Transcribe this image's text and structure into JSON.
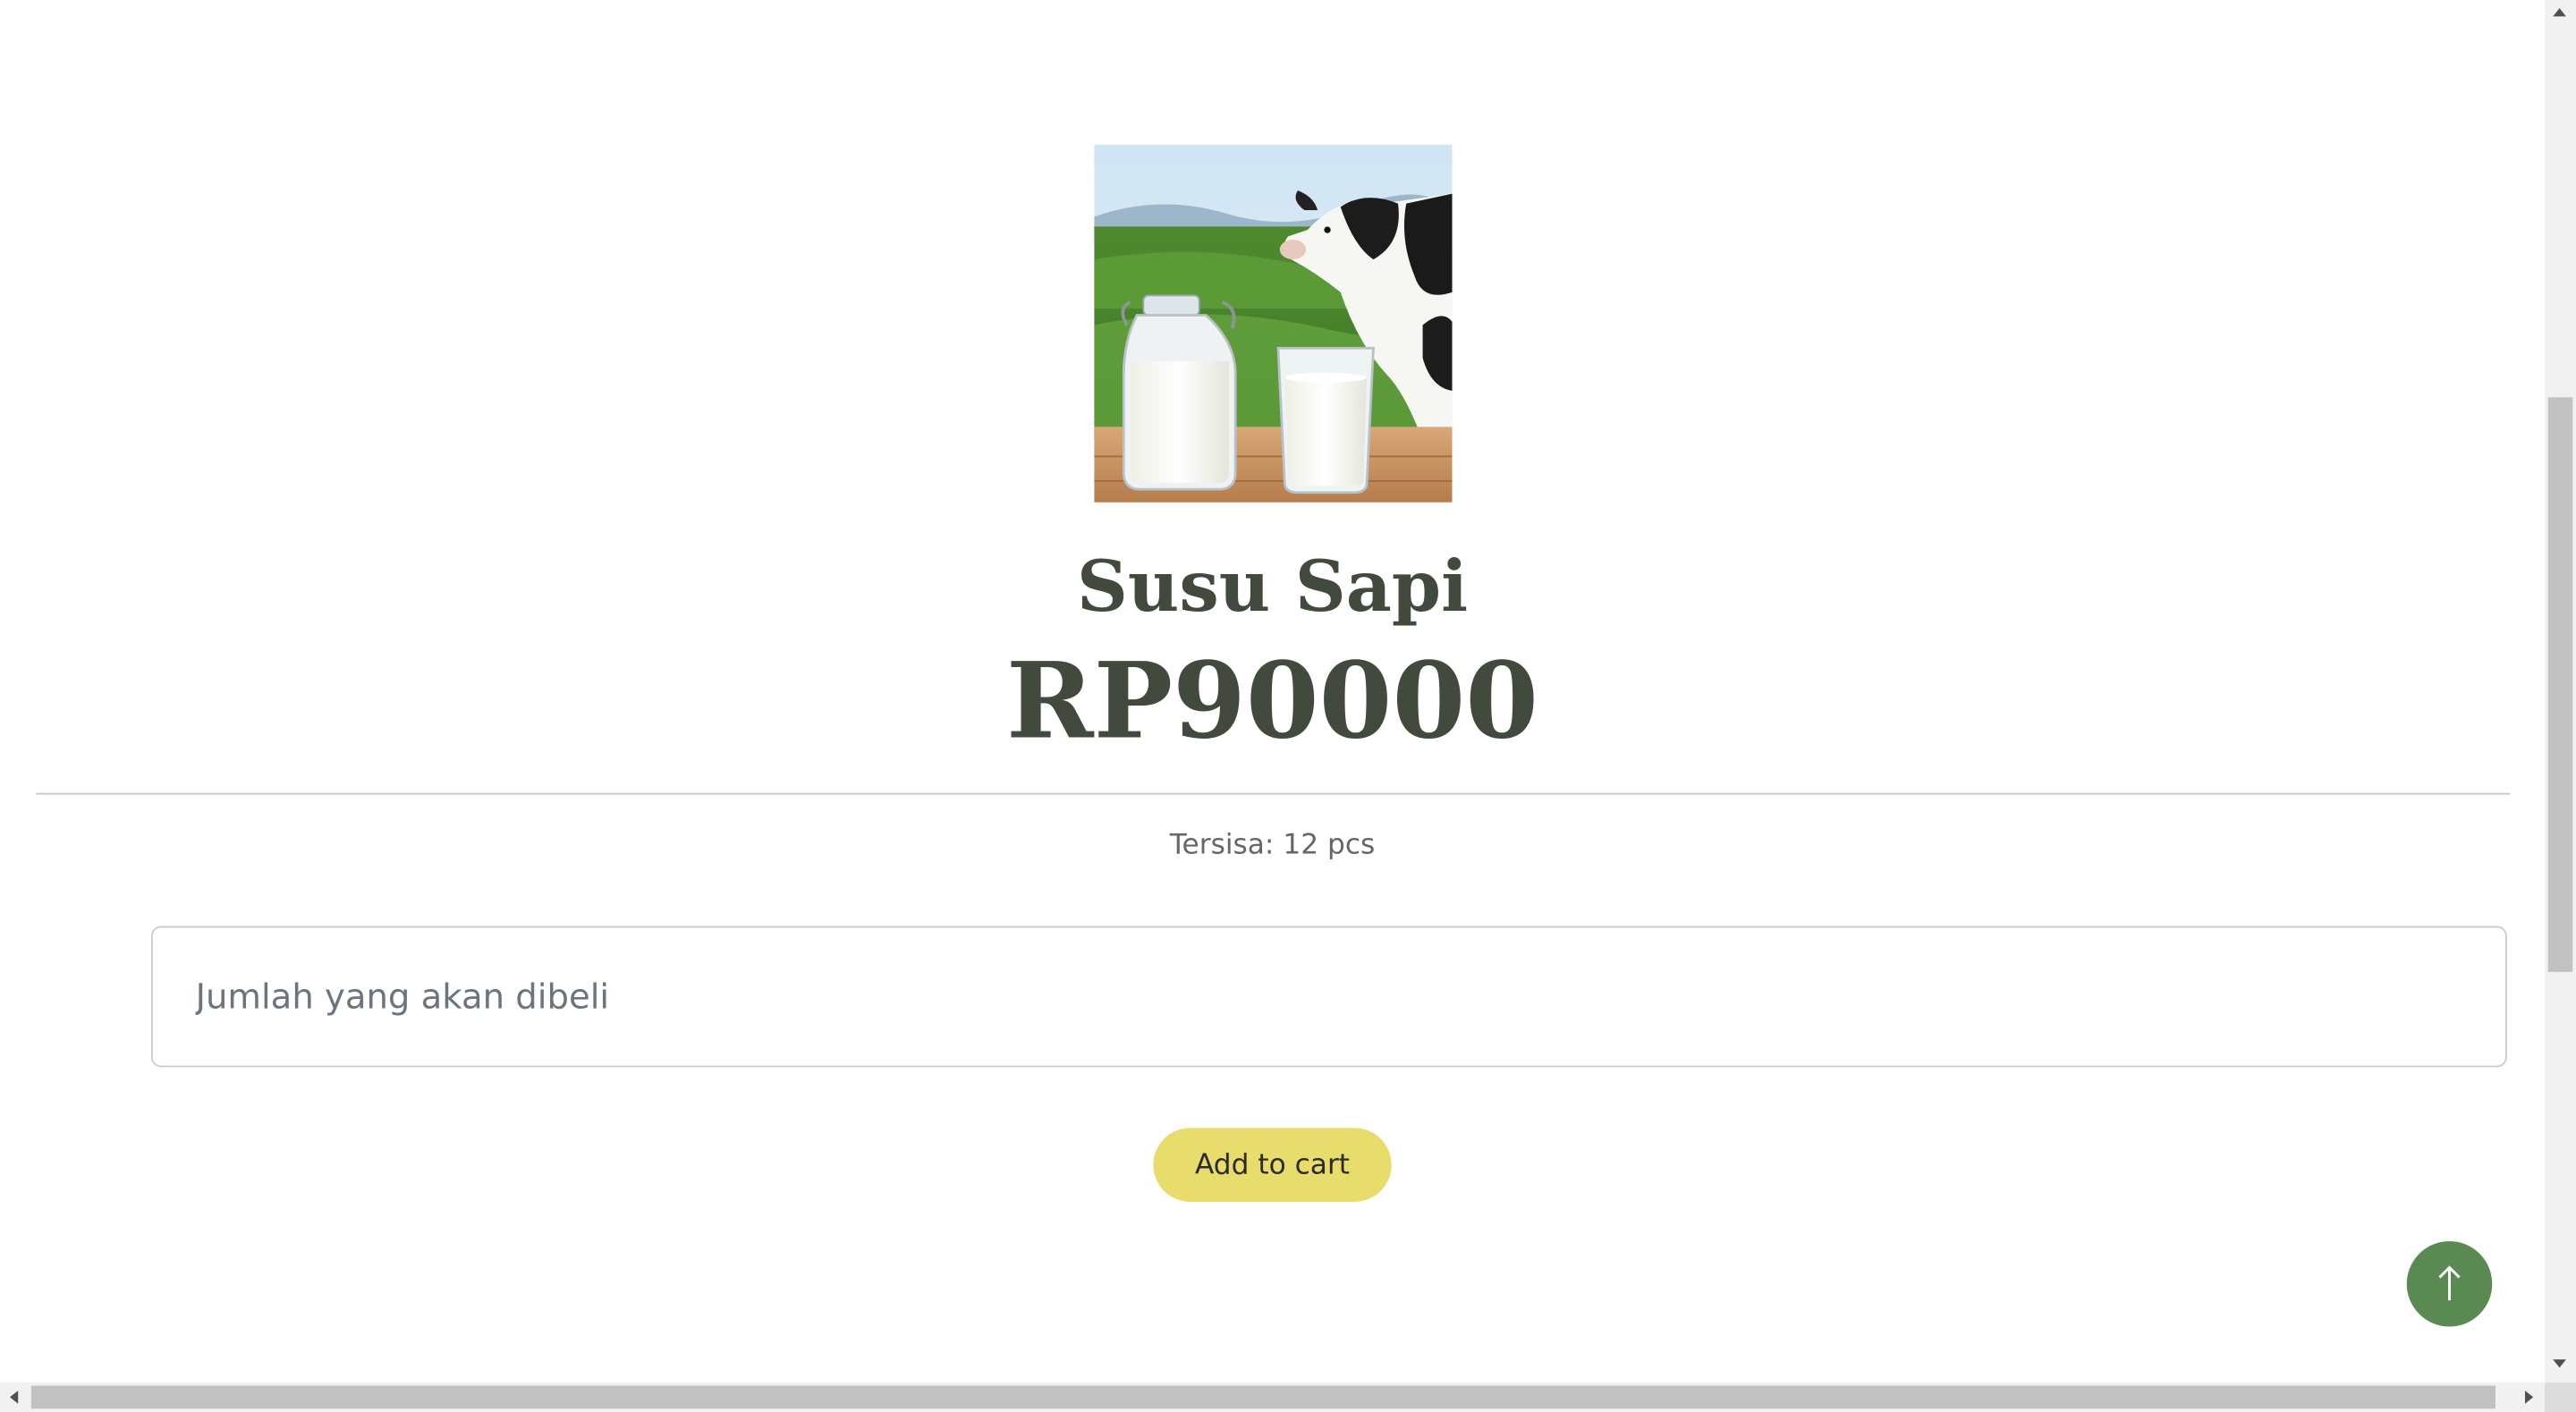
{
  "product": {
    "name": "Susu Sapi",
    "price": "RP90000",
    "stock_text": "Tersisa: 12 pcs",
    "image_icon": "milk-and-cow-image"
  },
  "order_form": {
    "quantity_value": "",
    "quantity_placeholder": "Jumlah yang akan dibeli",
    "add_to_cart_label": "Add to cart"
  },
  "back_to_top": {
    "icon": "arrow-up-icon"
  },
  "colors": {
    "heading": "#414a3c",
    "add_to_cart_bg": "#e8dc6c",
    "back_to_top_bg": "#5a8a52"
  }
}
